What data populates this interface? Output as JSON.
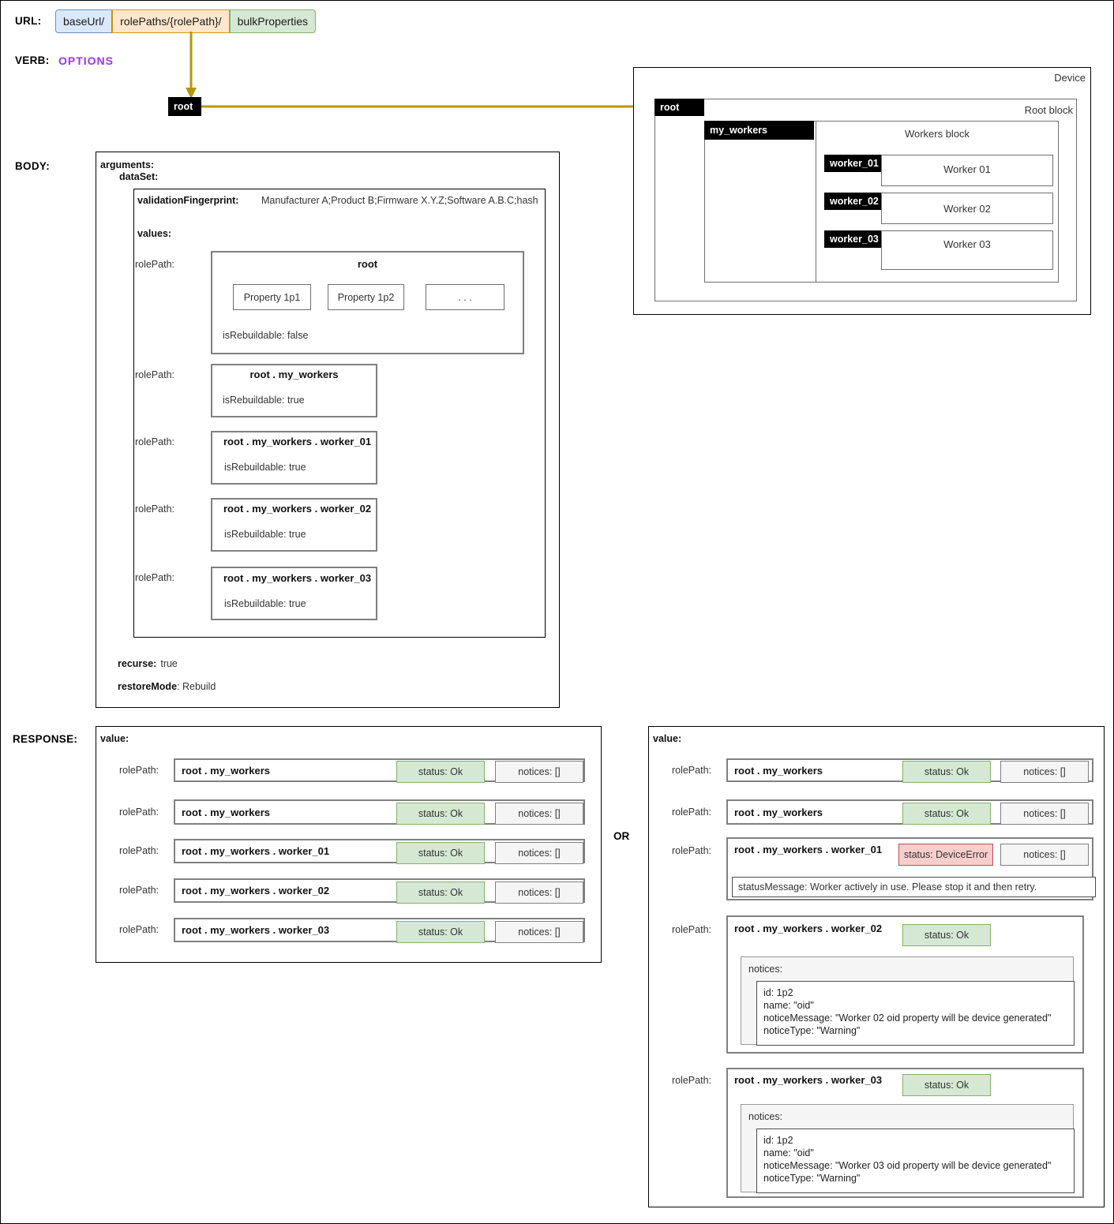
{
  "labels": {
    "url": "URL:",
    "verb": "VERB:",
    "body": "BODY:",
    "response": "RESPONSE:",
    "or": "OR"
  },
  "url": {
    "segments": [
      {
        "text": "baseUrl/",
        "color": "#dae8fc",
        "border": "#6c8ebf"
      },
      {
        "text": "rolePaths/{rolePath}/",
        "color": "#ffe6cc",
        "border": "#d79b00"
      },
      {
        "text": "bulkProperties",
        "color": "#d5e8d4",
        "border": "#82b366"
      }
    ]
  },
  "verb": {
    "value": "OPTIONS"
  },
  "source_node": {
    "label": "root"
  },
  "device": {
    "title": "Device",
    "root_block": {
      "title": "Root block",
      "tab": "root"
    },
    "workers_block": {
      "title": "Workers block",
      "tab": "my_workers"
    },
    "workers": [
      {
        "tab": "worker_01",
        "title": "Worker 01"
      },
      {
        "tab": "worker_02",
        "title": "Worker 02"
      },
      {
        "tab": "worker_03",
        "title": "Worker 03"
      }
    ]
  },
  "body": {
    "arguments_label": "arguments:",
    "dataset_label": "dataSet:",
    "fingerprint_key": "validationFingerprint:",
    "fingerprint_value": "Manufacturer A;Product B;Firmware X.Y.Z;Software A.B.C;hash",
    "values_label": "values:",
    "rolepath_label": "rolePath:",
    "root_entry": {
      "path": "root",
      "properties": [
        "Property 1p1",
        "Property 1p2",
        ". . ."
      ],
      "rebuildable": "isRebuildable: false"
    },
    "entries": [
      {
        "path": "root . my_workers",
        "rebuildable": "isRebuildable: true"
      },
      {
        "path": "root . my_workers . worker_01",
        "rebuildable": "isRebuildable: true"
      },
      {
        "path": "root . my_workers . worker_02",
        "rebuildable": "isRebuildable: true"
      },
      {
        "path": "root . my_workers . worker_03",
        "rebuildable": "isRebuildable: true"
      }
    ],
    "recurse_key": "recurse:",
    "recurse_value": "true",
    "restore_key": "restoreMode",
    "restore_value": ": Rebuild"
  },
  "response_left": {
    "value_label": "value:",
    "rolepath_label": "rolePath:",
    "rows": [
      {
        "path": "root . my_workers",
        "status": "status: Ok",
        "notices": "notices: []"
      },
      {
        "path": "root . my_workers",
        "status": "status: Ok",
        "notices": "notices: []"
      },
      {
        "path": "root . my_workers . worker_01",
        "status": "status: Ok",
        "notices": "notices: []"
      },
      {
        "path": "root . my_workers . worker_02",
        "status": "status: Ok",
        "notices": "notices: []"
      },
      {
        "path": "root . my_workers . worker_03",
        "status": "status: Ok",
        "notices": "notices: []"
      }
    ]
  },
  "response_right": {
    "value_label": "value:",
    "rolepath_label": "rolePath:",
    "row1": {
      "path": "root . my_workers",
      "status": "status: Ok",
      "notices": "notices: []"
    },
    "row2": {
      "path": "root . my_workers",
      "status": "status: Ok",
      "notices": "notices: []"
    },
    "row3": {
      "path": "root . my_workers . worker_01",
      "status": "status: DeviceError",
      "notices": "notices: []",
      "status_message": "statusMessage: Worker actively in use. Please stop it and then retry."
    },
    "row4": {
      "path": "root . my_workers . worker_02",
      "status": "status: Ok",
      "notices_label": "notices:",
      "notice_body": "id: 1p2\nname: \"oid\"\nnoticeMessage: \"Worker 02 oid property will be device generated\"\nnoticeType: \"Warning\""
    },
    "row5": {
      "path": "root . my_workers . worker_03",
      "status": "status: Ok",
      "notices_label": "notices:",
      "notice_body": "id: 1p2\nname: \"oid\"\nnoticeMessage: \"Worker 03 oid property will be device generated\"\nnoticeType: \"Warning\""
    }
  }
}
